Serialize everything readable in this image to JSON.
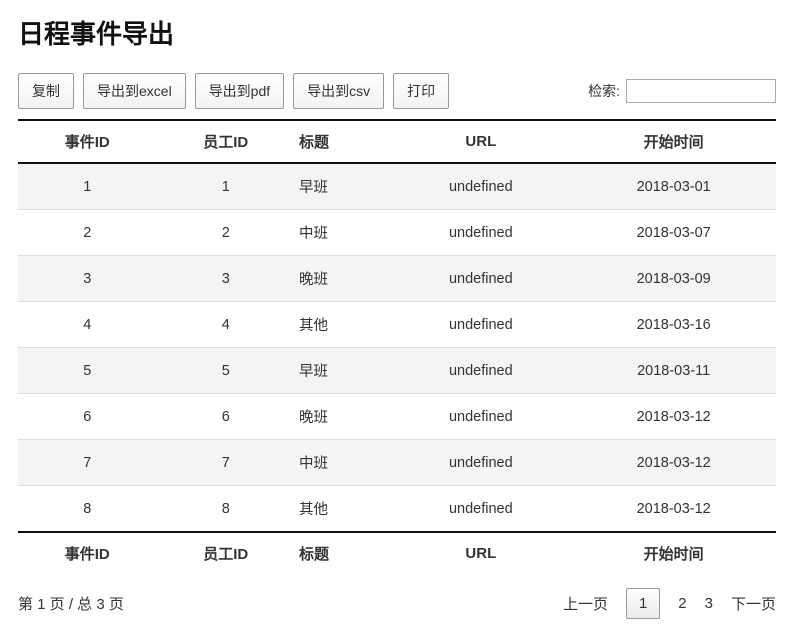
{
  "title": "日程事件导出",
  "buttons": {
    "copy": "复制",
    "excel": "导出到excel",
    "pdf": "导出到pdf",
    "csv": "导出到csv",
    "print": "打印"
  },
  "search": {
    "label": "检索:",
    "value": ""
  },
  "columns": {
    "c0": "事件ID",
    "c1": "员工ID",
    "c2": "标题",
    "c3": "URL",
    "c4": "开始时间"
  },
  "rows": [
    {
      "event_id": "1",
      "emp_id": "1",
      "title": "早班",
      "url": "undefined",
      "start": "2018-03-01"
    },
    {
      "event_id": "2",
      "emp_id": "2",
      "title": "中班",
      "url": "undefined",
      "start": "2018-03-07"
    },
    {
      "event_id": "3",
      "emp_id": "3",
      "title": "晚班",
      "url": "undefined",
      "start": "2018-03-09"
    },
    {
      "event_id": "4",
      "emp_id": "4",
      "title": "其他",
      "url": "undefined",
      "start": "2018-03-16"
    },
    {
      "event_id": "5",
      "emp_id": "5",
      "title": "早班",
      "url": "undefined",
      "start": "2018-03-11"
    },
    {
      "event_id": "6",
      "emp_id": "6",
      "title": "晚班",
      "url": "undefined",
      "start": "2018-03-12"
    },
    {
      "event_id": "7",
      "emp_id": "7",
      "title": "中班",
      "url": "undefined",
      "start": "2018-03-12"
    },
    {
      "event_id": "8",
      "emp_id": "8",
      "title": "其他",
      "url": "undefined",
      "start": "2018-03-12"
    }
  ],
  "pagination": {
    "info": "第 1 页 / 总 3 页",
    "prev": "上一页",
    "next": "下一页",
    "pages": [
      "1",
      "2",
      "3"
    ],
    "current": "1"
  }
}
